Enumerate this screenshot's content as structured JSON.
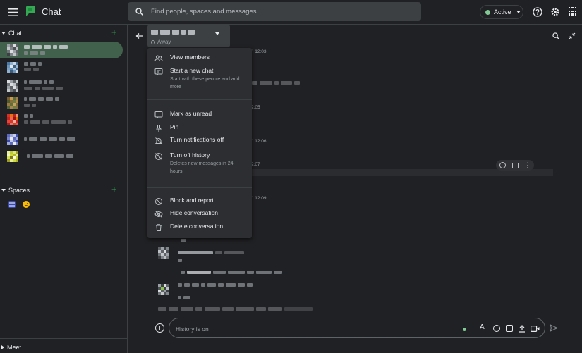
{
  "app": {
    "title": "Chat"
  },
  "search": {
    "placeholder": "Find people, spaces and messages"
  },
  "status": {
    "label": "Active",
    "color": "#81c995"
  },
  "sidebar": {
    "chat_header": "Chat",
    "spaces_header": "Spaces",
    "meet_header": "Meet"
  },
  "conversation": {
    "presence": "Away",
    "timestamps": [
      "7, 12:03",
      "2:05",
      "7, 12:06",
      "2:07",
      "7, 12:09"
    ]
  },
  "menu": {
    "items": [
      {
        "label": "View members",
        "icon": "people-icon"
      },
      {
        "label": "Start a new chat",
        "sub": "Start with these people and add more",
        "icon": "new-chat-icon"
      },
      {
        "label": "Mark as unread",
        "icon": "mark-unread-icon"
      },
      {
        "label": "Pin",
        "icon": "pin-icon"
      },
      {
        "label": "Turn notifications off",
        "icon": "bell-off-icon"
      },
      {
        "label": "Turn off history",
        "sub": "Deletes new messages in 24 hours",
        "icon": "history-off-icon"
      },
      {
        "label": "Block and report",
        "icon": "block-icon"
      },
      {
        "label": "Hide conversation",
        "icon": "hide-icon"
      },
      {
        "label": "Delete conversation",
        "icon": "trash-icon"
      }
    ]
  },
  "composer": {
    "placeholder": "History is on"
  },
  "colors": {
    "accent_green": "#34a853",
    "background": "#202124",
    "menu_bg": "#2d2e31"
  }
}
